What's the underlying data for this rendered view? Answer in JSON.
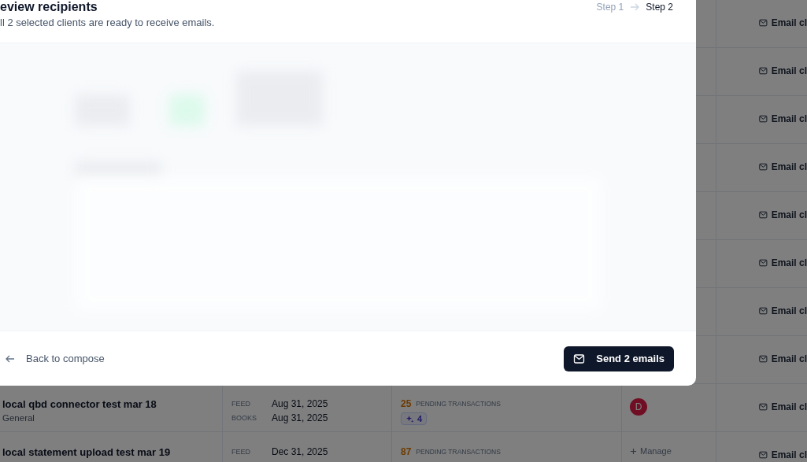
{
  "modal": {
    "title": "eview recipients",
    "subtitle": "ll 2 selected clients are ready to receive emails.",
    "steps": [
      {
        "label": "Step 1",
        "selected": false
      },
      {
        "label": "Step 2",
        "selected": true
      }
    ],
    "back_link": "Back to compose",
    "send_button": "Send 2 emails"
  },
  "table": {
    "rows": [
      {
        "email_action": "Email cl"
      },
      {
        "email_action": "Email cl"
      },
      {
        "email_action": "Email cl"
      },
      {
        "email_action": "Email cl"
      },
      {
        "email_action": "Email cl"
      },
      {
        "email_action": "Email cl"
      },
      {
        "email_action": "Email cl"
      },
      {
        "email_action": "Email cl"
      },
      {
        "name": "local qbd connector test mar 18",
        "group": "General",
        "feed_label": "FEED",
        "feed_date": "Aug 31, 2025",
        "books_label": "BOOKS",
        "books_date": "Aug 31, 2025",
        "pending_count": "25",
        "pending_label": "PENDING TRANSACTIONS",
        "badge_count": "4",
        "assignee_initial": "D",
        "email_action": "Email cl"
      },
      {
        "name": "local statement upload test mar 19",
        "feed_label": "FEED",
        "feed_date": "Dec 31, 2025",
        "pending_count": "87",
        "pending_label": "PENDING TRANSACTIONS",
        "manage_link": "Manage",
        "email_action": "Email cl"
      }
    ]
  }
}
